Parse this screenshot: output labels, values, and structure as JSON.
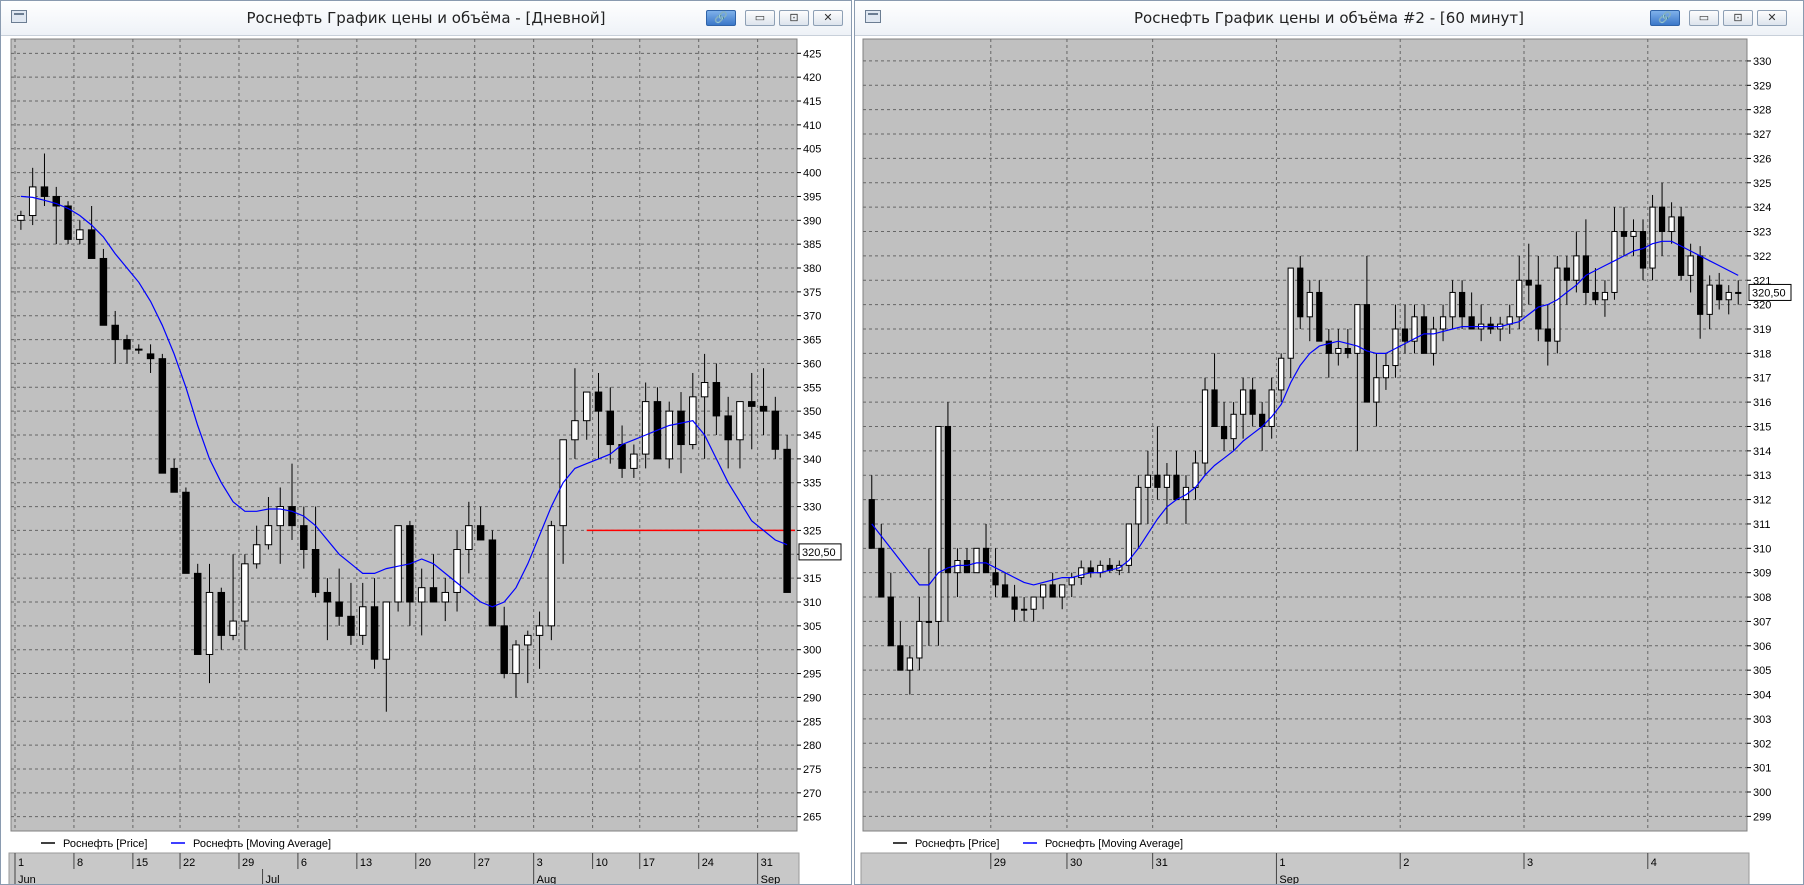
{
  "windows": [
    {
      "title": "Роснефть График цены и объёма - [Дневной]",
      "buttons": {
        "link": "🔗",
        "minimize": "▭",
        "restore": "⊡",
        "close": "✕"
      },
      "price_tag": "320,50",
      "legend": [
        {
          "label": "Роснефть [Price]",
          "color": "#000000"
        },
        {
          "label": "Роснефть [Moving Average]",
          "color": "#0000ff"
        }
      ]
    },
    {
      "title": "Роснефть График цены и объёма #2 - [60 минут]",
      "buttons": {
        "link": "🔗",
        "minimize": "▭",
        "restore": "⊡",
        "close": "✕"
      },
      "price_tag": "320,50",
      "legend": [
        {
          "label": "Роснефть [Price]",
          "color": "#000000"
        },
        {
          "label": "Роснефть [Moving Average]",
          "color": "#0000ff"
        }
      ]
    }
  ],
  "chart_data": [
    {
      "type": "candlestick",
      "timeframe": "Дневной",
      "ylim": [
        262,
        428
      ],
      "ytick_step": 5,
      "grid": true,
      "bar_count": 66,
      "x_labels_top": [
        {
          "label": "1",
          "bar": 0
        },
        {
          "label": "8",
          "bar": 5
        },
        {
          "label": "15",
          "bar": 10
        },
        {
          "label": "22",
          "bar": 14
        },
        {
          "label": "29",
          "bar": 19
        },
        {
          "label": "6",
          "bar": 24
        },
        {
          "label": "13",
          "bar": 29
        },
        {
          "label": "20",
          "bar": 34
        },
        {
          "label": "27",
          "bar": 39
        },
        {
          "label": "3",
          "bar": 44
        },
        {
          "label": "10",
          "bar": 49
        },
        {
          "label": "17",
          "bar": 53
        },
        {
          "label": "24",
          "bar": 58
        },
        {
          "label": "31",
          "bar": 63
        }
      ],
      "x_labels_bottom": [
        {
          "label": "Jun",
          "bar": 0
        },
        {
          "label": "Jul",
          "bar": 21
        },
        {
          "label": "Aug",
          "bar": 44
        },
        {
          "label": "Sep",
          "bar": 63
        }
      ],
      "hline": {
        "value": 325,
        "from_bar": 48,
        "color": "#ff0000"
      },
      "last_price": 320.5,
      "ohlc": [
        [
          390,
          392,
          388,
          391
        ],
        [
          391,
          401,
          389,
          397
        ],
        [
          397,
          404,
          393,
          395
        ],
        [
          395,
          397,
          385,
          393
        ],
        [
          393,
          394,
          385,
          386
        ],
        [
          386,
          390,
          385,
          388
        ],
        [
          388,
          393,
          382,
          382
        ],
        [
          382,
          384,
          369,
          368
        ],
        [
          368,
          371,
          360,
          365
        ],
        [
          365,
          366,
          360,
          363
        ],
        [
          363,
          364,
          362,
          363
        ],
        [
          362,
          364,
          358,
          361
        ],
        [
          361,
          362,
          339,
          337
        ],
        [
          338,
          340,
          334,
          333
        ],
        [
          333,
          334,
          319,
          316
        ],
        [
          316,
          318,
          299,
          299
        ],
        [
          299,
          318,
          293,
          312
        ],
        [
          312,
          313,
          300,
          303
        ],
        [
          303,
          320,
          302,
          306
        ],
        [
          306,
          320,
          300,
          318
        ],
        [
          318,
          326,
          317,
          322
        ],
        [
          322,
          332,
          321,
          326
        ],
        [
          326,
          334,
          318,
          330
        ],
        [
          330,
          339,
          323,
          326
        ],
        [
          326,
          330,
          317,
          321
        ],
        [
          321,
          330,
          311,
          312
        ],
        [
          312,
          315,
          302,
          310
        ],
        [
          310,
          317,
          305,
          307
        ],
        [
          307,
          314,
          301,
          303
        ],
        [
          303,
          314,
          301,
          309
        ],
        [
          309,
          315,
          296,
          298
        ],
        [
          298,
          299,
          287,
          310
        ],
        [
          310,
          324,
          308,
          326
        ],
        [
          326,
          327,
          305,
          310
        ],
        [
          310,
          317,
          303,
          313
        ],
        [
          313,
          320,
          310,
          310
        ],
        [
          310,
          315,
          306,
          312
        ],
        [
          312,
          325,
          308,
          321
        ],
        [
          321,
          331,
          316,
          326
        ],
        [
          326,
          330,
          323,
          323
        ],
        [
          323,
          325,
          306,
          305
        ],
        [
          305,
          309,
          294,
          295
        ],
        [
          295,
          302,
          290,
          301
        ],
        [
          301,
          304,
          293,
          303
        ],
        [
          303,
          308,
          296,
          305
        ],
        [
          305,
          327,
          302,
          326
        ],
        [
          326,
          341,
          318,
          344
        ],
        [
          344,
          359,
          340,
          348
        ],
        [
          348,
          352,
          344,
          354
        ],
        [
          354,
          358,
          340,
          350
        ],
        [
          350,
          355,
          339,
          343
        ],
        [
          343,
          347,
          336,
          338
        ],
        [
          338,
          343,
          336,
          341
        ],
        [
          341,
          356,
          338,
          352
        ],
        [
          352,
          355,
          340,
          340
        ],
        [
          340,
          352,
          338,
          350
        ],
        [
          350,
          354,
          337,
          343
        ],
        [
          343,
          358,
          342,
          353
        ],
        [
          353,
          362,
          340,
          356
        ],
        [
          356,
          360,
          345,
          349
        ],
        [
          349,
          353,
          338,
          344
        ],
        [
          344,
          349,
          338,
          352
        ],
        [
          352,
          358,
          342,
          351
        ],
        [
          351,
          359,
          345,
          350
        ],
        [
          350,
          353,
          340,
          342
        ],
        [
          342,
          345,
          318,
          312
        ]
      ],
      "ma": [
        395,
        394.8,
        394.2,
        393.5,
        392.5,
        391,
        389,
        386.5,
        383,
        380,
        377,
        373,
        368,
        362,
        355,
        347,
        340,
        335,
        331,
        329,
        329,
        329.5,
        329.5,
        329,
        328,
        326,
        323,
        320,
        318,
        316,
        316,
        317,
        317.5,
        318,
        319,
        318,
        316,
        314,
        312,
        310,
        309,
        310,
        313,
        318,
        324,
        330,
        335,
        338,
        339,
        340,
        341,
        343,
        344,
        345,
        346,
        347,
        347.5,
        348,
        345,
        340,
        335,
        331,
        327,
        325,
        323,
        322
      ]
    },
    {
      "type": "candlestick",
      "timeframe": "60 минут",
      "ylim": [
        298.4,
        330.9
      ],
      "ytick_step": 1,
      "grid": true,
      "bar_count": 92,
      "x_labels_top": [
        {
          "label": "29",
          "bar": 13
        },
        {
          "label": "30",
          "bar": 21
        },
        {
          "label": "31",
          "bar": 30
        },
        {
          "label": "1",
          "bar": 43
        },
        {
          "label": "2",
          "bar": 56
        },
        {
          "label": "3",
          "bar": 69
        },
        {
          "label": "4",
          "bar": 82
        }
      ],
      "x_labels_bottom": [
        {
          "label": "Sep",
          "bar": 43
        }
      ],
      "last_price": 320.5,
      "ohlc": [
        [
          312,
          313,
          310,
          310
        ],
        [
          310,
          311,
          308,
          308
        ],
        [
          308,
          309,
          306,
          306
        ],
        [
          306,
          307,
          305,
          305
        ],
        [
          305,
          306,
          304,
          305.5
        ],
        [
          305.5,
          308,
          305,
          307
        ],
        [
          307,
          310,
          306,
          307
        ],
        [
          307,
          315,
          306,
          315
        ],
        [
          315,
          316,
          307,
          309
        ],
        [
          309,
          310,
          308,
          309.5
        ],
        [
          309.5,
          310,
          309,
          309
        ],
        [
          309,
          310,
          309,
          310
        ],
        [
          310,
          311,
          309,
          309
        ],
        [
          309,
          310,
          308,
          308.5
        ],
        [
          308.5,
          309,
          308,
          308
        ],
        [
          308,
          308.5,
          307,
          307.5
        ],
        [
          307.5,
          308,
          307,
          307.5
        ],
        [
          307.5,
          308,
          307,
          308
        ],
        [
          308,
          308.5,
          307.5,
          308.5
        ],
        [
          308.5,
          309,
          308,
          308
        ],
        [
          308,
          308.5,
          307.5,
          308.5
        ],
        [
          308.5,
          309,
          308,
          308.8
        ],
        [
          308.8,
          309.5,
          308.5,
          309.2
        ],
        [
          309.2,
          309.5,
          308.8,
          309
        ],
        [
          309,
          309.5,
          308.8,
          309.3
        ],
        [
          309.3,
          309.6,
          309,
          309.1
        ],
        [
          309.1,
          309.5,
          308.9,
          309.3
        ],
        [
          309.3,
          310,
          309,
          311
        ],
        [
          311,
          313,
          310,
          312.5
        ],
        [
          312.5,
          314,
          311,
          313
        ],
        [
          313,
          315,
          312,
          312.5
        ],
        [
          312.5,
          313.5,
          311,
          313
        ],
        [
          313,
          314,
          312,
          312
        ],
        [
          312,
          313,
          311,
          312.5
        ],
        [
          312.5,
          314,
          312,
          313.5
        ],
        [
          313.5,
          317,
          313,
          316.5
        ],
        [
          316.5,
          318,
          315,
          315
        ],
        [
          315,
          316,
          314,
          314.5
        ],
        [
          314.5,
          316,
          314,
          315.5
        ],
        [
          315.5,
          317,
          314.5,
          316.5
        ],
        [
          316.5,
          317,
          315,
          315.5
        ],
        [
          315.5,
          316,
          314,
          315
        ],
        [
          315,
          317,
          314.5,
          316.5
        ],
        [
          316.5,
          318,
          316,
          317.8
        ],
        [
          317.8,
          321.5,
          317,
          321.5
        ],
        [
          321.5,
          322,
          319,
          319.5
        ],
        [
          319.5,
          321,
          318.5,
          320.5
        ],
        [
          320.5,
          321,
          319,
          318.5
        ],
        [
          318.5,
          319,
          317,
          318
        ],
        [
          318,
          319,
          317.5,
          318.2
        ],
        [
          318.2,
          319,
          317.8,
          318
        ],
        [
          318,
          319,
          314,
          320
        ],
        [
          320,
          322,
          316,
          316
        ],
        [
          316,
          318,
          315,
          317
        ],
        [
          317,
          318,
          316.5,
          317.5
        ],
        [
          317.5,
          320,
          317,
          319
        ],
        [
          319,
          320,
          318,
          318.5
        ],
        [
          318.5,
          320,
          318,
          319.5
        ],
        [
          319.5,
          320,
          318.5,
          318
        ],
        [
          318,
          319.5,
          317.5,
          319
        ],
        [
          319,
          320,
          318.5,
          319.5
        ],
        [
          319.5,
          321,
          319,
          320.5
        ],
        [
          320.5,
          321,
          319,
          319.5
        ],
        [
          319.5,
          320.5,
          319,
          319
        ],
        [
          319,
          320,
          318.5,
          319.2
        ],
        [
          319.2,
          319.5,
          318.8,
          319
        ],
        [
          319,
          319.5,
          318.5,
          319.2
        ],
        [
          319.2,
          320,
          318.8,
          319.5
        ],
        [
          319.5,
          322,
          319,
          321
        ],
        [
          321,
          322.5,
          320,
          320.8
        ],
        [
          320.8,
          322,
          318.5,
          319
        ],
        [
          319,
          320,
          317.5,
          318.5
        ],
        [
          318.5,
          322,
          318,
          321.5
        ],
        [
          321.5,
          322,
          320,
          321
        ],
        [
          321,
          323,
          320.5,
          322
        ],
        [
          322,
          323.5,
          320,
          320.5
        ],
        [
          320.5,
          321.5,
          320,
          320.2
        ],
        [
          320.2,
          321,
          319.5,
          320.5
        ],
        [
          320.5,
          324,
          320.2,
          323
        ],
        [
          323,
          324,
          322,
          322.8
        ],
        [
          322.8,
          323.5,
          322,
          323
        ],
        [
          323,
          323.5,
          321,
          321.5
        ],
        [
          321.5,
          324.5,
          321,
          324
        ],
        [
          324,
          325,
          322,
          323
        ],
        [
          323,
          324.2,
          322.5,
          323.6
        ],
        [
          323.6,
          324,
          321,
          321.2
        ],
        [
          321.2,
          322.5,
          320.5,
          322
        ],
        [
          322,
          322.4,
          318.6,
          319.6
        ],
        [
          319.6,
          321.2,
          319,
          320.8
        ],
        [
          320.8,
          321.3,
          319.8,
          320.2
        ],
        [
          320.2,
          320.8,
          319.6,
          320.5
        ],
        [
          320.5,
          321,
          320,
          320.5
        ]
      ],
      "ma": [
        311,
        310.5,
        310,
        309.5,
        309,
        308.5,
        308.5,
        309,
        309.2,
        309.3,
        309.3,
        309.4,
        309.4,
        309.2,
        309,
        308.8,
        308.6,
        308.5,
        308.6,
        308.7,
        308.8,
        308.8,
        308.9,
        309,
        309,
        309.1,
        309.2,
        309.5,
        310,
        310.6,
        311.2,
        311.7,
        312,
        312.2,
        312.5,
        313,
        313.4,
        313.7,
        314,
        314.4,
        314.7,
        315,
        315.4,
        315.9,
        316.8,
        317.5,
        318,
        318.3,
        318.4,
        318.5,
        318.4,
        318.3,
        318.1,
        318,
        318,
        318.2,
        318.4,
        318.6,
        318.8,
        318.8,
        318.9,
        319,
        319.1,
        319.1,
        319.1,
        319.1,
        319.1,
        319.2,
        319.3,
        319.6,
        319.9,
        320,
        320.2,
        320.5,
        320.8,
        321.2,
        321.4,
        321.6,
        321.8,
        322,
        322.2,
        322.3,
        322.5,
        322.6,
        322.6,
        322.4,
        322.2,
        322,
        321.8,
        321.6,
        321.4,
        321.2
      ]
    }
  ]
}
